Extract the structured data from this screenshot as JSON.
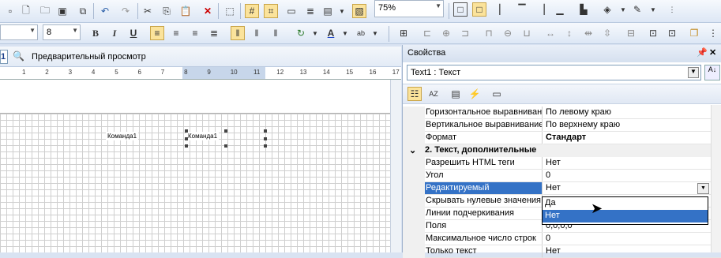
{
  "toolbar": {
    "zoom": "75%",
    "font_size": "8"
  },
  "tabs": {
    "active_num": "1",
    "preview_label": "Предварительный просмотр"
  },
  "ruler": [
    "1",
    "2",
    "3",
    "4",
    "5",
    "6",
    "7",
    "8",
    "9",
    "10",
    "11",
    "12",
    "13",
    "14",
    "15",
    "16",
    "17"
  ],
  "canvas": {
    "field1": "Команда1",
    "field2": "Команда1"
  },
  "properties": {
    "title": "Свойства",
    "selected_object": "Text1 : Текст",
    "rows": [
      {
        "key": "Горизонтальное выравнивание",
        "value": "По левому краю"
      },
      {
        "key": "Вертикальное выравнивание",
        "value": "По верхнему краю"
      },
      {
        "key": "Формат",
        "value": "Стандарт"
      },
      {
        "category": "2. Текст, дополнительные"
      },
      {
        "key": "Разрешить HTML теги",
        "value": "Нет"
      },
      {
        "key": "Угол",
        "value": "0"
      },
      {
        "key": "Редактируемый",
        "value": "Нет"
      },
      {
        "key": "Скрывать нулевые значения",
        "value": ""
      },
      {
        "key": "Линии подчеркивания",
        "value": ""
      },
      {
        "key": "Поля",
        "value": "0;0;0;0"
      },
      {
        "key": "Максимальное число строк",
        "value": "0"
      },
      {
        "key": "Только текст",
        "value": "Нет"
      }
    ],
    "dropdown_options": [
      "Да",
      "Нет"
    ]
  },
  "colors": {
    "selection": "#3472c6",
    "accent": "#fbe39b"
  }
}
